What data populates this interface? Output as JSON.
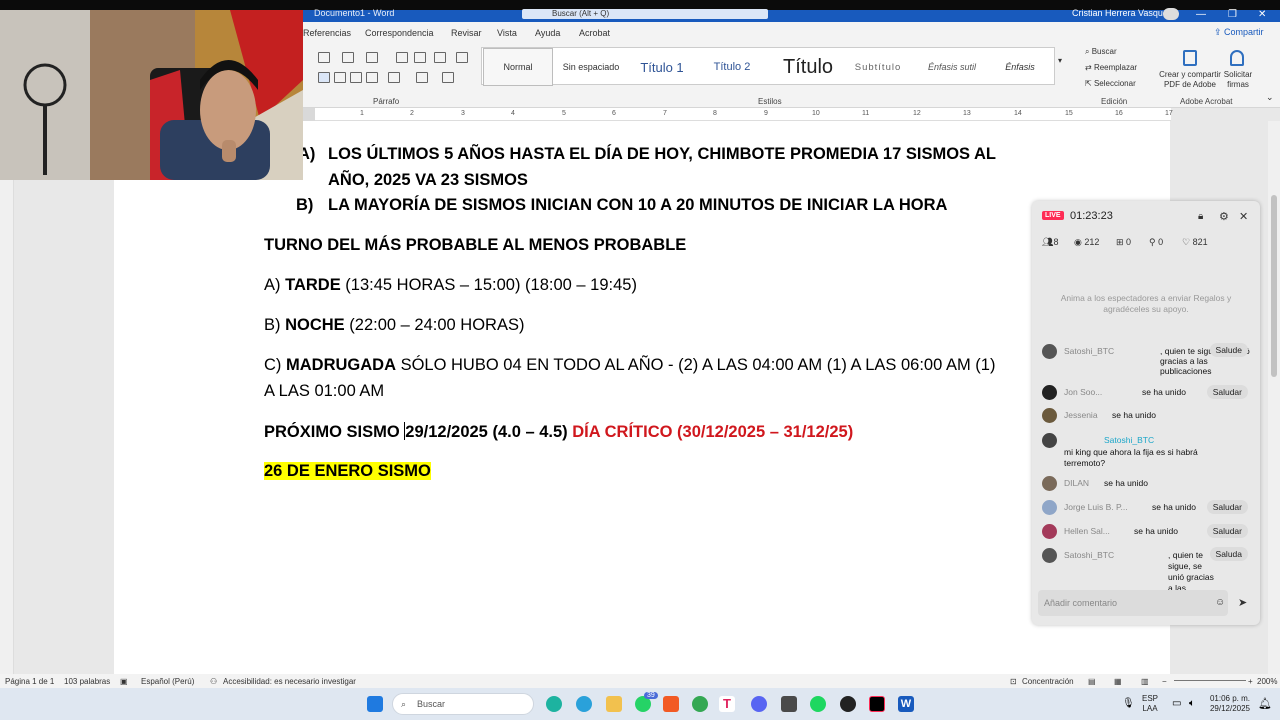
{
  "window": {
    "doc_title": "Documento1 - Word",
    "search_placeholder": "Buscar (Alt + Q)",
    "user_name": "Cristian Herrera Vasquez"
  },
  "ribbon": {
    "tabs": [
      "Referencias",
      "Correspondencia",
      "Revisar",
      "Vista",
      "Ayuda",
      "Acrobat"
    ],
    "share_label": "Compartir",
    "groups": {
      "paragraph": "Párrafo",
      "styles": "Estilos",
      "editing": "Edición",
      "adobe": "Adobe Acrobat"
    },
    "styles": [
      "Normal",
      "Sin espaciado",
      "Título 1",
      "Título 2",
      "Título",
      "Subtítulo",
      "Énfasis sutil",
      "Énfasis"
    ],
    "editing": {
      "find": "Buscar",
      "replace": "Reemplazar",
      "select": "Seleccionar"
    },
    "adobe": {
      "create_line1": "Crear y compartir",
      "create_line2": "PDF de Adobe",
      "sign_line1": "Solicitar",
      "sign_line2": "firmas"
    }
  },
  "ruler": {
    "numbers": [
      "1",
      "2",
      "3",
      "4",
      "5",
      "6",
      "7",
      "8",
      "9",
      "10",
      "11",
      "12",
      "13",
      "14",
      "15",
      "16",
      "17"
    ]
  },
  "document": {
    "item_a_marker": "A)",
    "item_a_line1": "LOS ÚLTIMOS 5 AÑOS HASTA EL DÍA DE HOY, CHIMBOTE PROMEDIA 17 SISMOS AL",
    "item_a_line2": "AÑO, 2025 VA 23 SISMOS",
    "item_b_marker": "B)",
    "item_b": "LA MAYORÍA DE SISMOS INICIAN CON 10 A 20 MINUTOS DE INICIAR LA HORA",
    "heading": "TURNO DEL MÁS PROBABLE AL MENOS PROBABLE",
    "tarde_prefix": "A) ",
    "tarde_label": "TARDE",
    "tarde_rest": " (13:45 HORAS – 15:00) (18:00 – 19:45)",
    "noche_prefix": "B) ",
    "noche_label": "NOCHE",
    "noche_rest": " (22:00 – 24:00 HORAS)",
    "madrugada_prefix": "C) ",
    "madrugada_label": "MADRUGADA",
    "madrugada_rest": " SÓLO HUBO 04 EN TODO AL AÑO - (2) A LAS 04:00 AM (1) A LAS 06:00 AM (1)",
    "madrugada_line2": "A LAS 01:00 AM",
    "next_label": "PRÓXIMO SISMO ",
    "next_value": "29/12/2025 (4.0 – 4.5) ",
    "critical": "DÍA CRÍTICO (30/12/2025 – 31/12/25)",
    "highlight": "26 DE ENERO SISMO"
  },
  "live": {
    "badge": "LIVE",
    "time": "01:23:23",
    "stats": {
      "people": "8",
      "viewers": "212",
      "gifts": "0",
      "shares": "0",
      "likes": "821"
    },
    "note": "Anima a los espectadores a enviar Regalos y agradéceles su apoyo.",
    "messages": [
      {
        "name": "Satoshi_BTC",
        "text": ", quien te sigue, se unió gracias a las publicaciones",
        "action": "Salude"
      },
      {
        "name": "Jon Soo...",
        "text": "se ha unido",
        "action": "Saludar"
      },
      {
        "name": "Jessenia",
        "text": "se ha unido",
        "action": ""
      },
      {
        "name": "Satoshi_BTC",
        "text": "mi king que ahora la fija es si habrá terremoto?",
        "action": ""
      },
      {
        "name": "DILAN",
        "text": "se ha unido",
        "action": ""
      },
      {
        "name": "Jorge Luis B. P...",
        "text": "se ha unido",
        "action": "Saludar"
      },
      {
        "name": "Hellen Sal...",
        "text": "se ha unido",
        "action": "Saludar"
      },
      {
        "name": "Satoshi_BTC",
        "text": ", quien te sigue, se unió gracias a las publicaciones",
        "action": "Saluda"
      }
    ],
    "comment_placeholder": "Añadir comentario"
  },
  "statusbar": {
    "page": "Página 1 de 1",
    "words": "103 palabras",
    "language": "Español (Perú)",
    "accessibility": "Accesibilidad: es necesario investigar",
    "focus": "Concentración",
    "zoom": "200%"
  },
  "taskbar": {
    "search_placeholder": "Buscar",
    "lang_line1": "ESP",
    "lang_line2": "LAA",
    "time": "01:06 p. m.",
    "date": "29/12/2025",
    "whatsapp_badge": "39"
  }
}
